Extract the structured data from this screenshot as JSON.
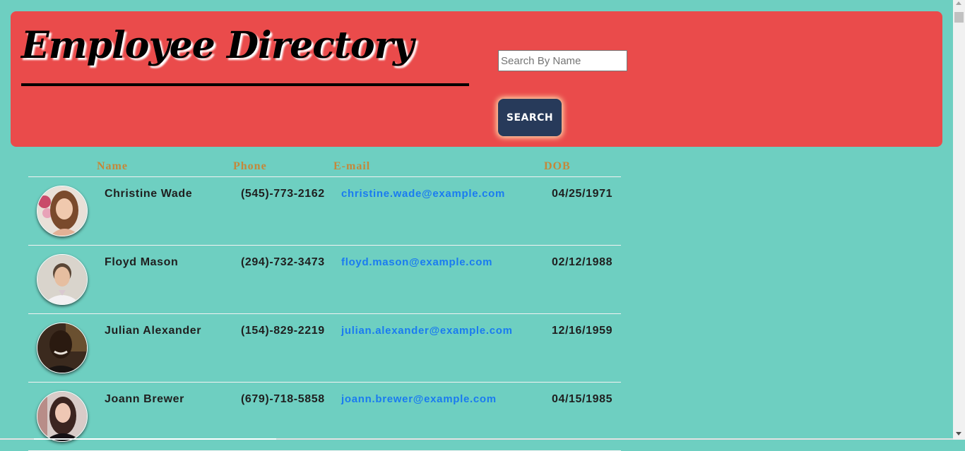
{
  "header": {
    "title": "Employee Directory",
    "search_placeholder": "Search By Name",
    "search_value": "",
    "search_button": "SEARCH"
  },
  "table": {
    "columns": [
      "Name",
      "Phone",
      "E-mail",
      "DOB"
    ],
    "rows": [
      {
        "name": "Christine Wade",
        "phone": "(545)-773-2162",
        "email": "christine.wade@example.com",
        "dob": "04/25/1971"
      },
      {
        "name": "Floyd Mason",
        "phone": "(294)-732-3473",
        "email": "floyd.mason@example.com",
        "dob": "02/12/1988"
      },
      {
        "name": "Julian Alexander",
        "phone": "(154)-829-2219",
        "email": "julian.alexander@example.com",
        "dob": "12/16/1959"
      },
      {
        "name": "Joann Brewer",
        "phone": "(679)-718-5858",
        "email": "joann.brewer@example.com",
        "dob": "04/15/1985"
      }
    ]
  },
  "colors": {
    "page_bg": "#6ecfc1",
    "header_bg": "#ea4b4b",
    "button_bg": "#273a5a",
    "column_header": "#c4883a",
    "email_link": "#1a7bf0"
  }
}
